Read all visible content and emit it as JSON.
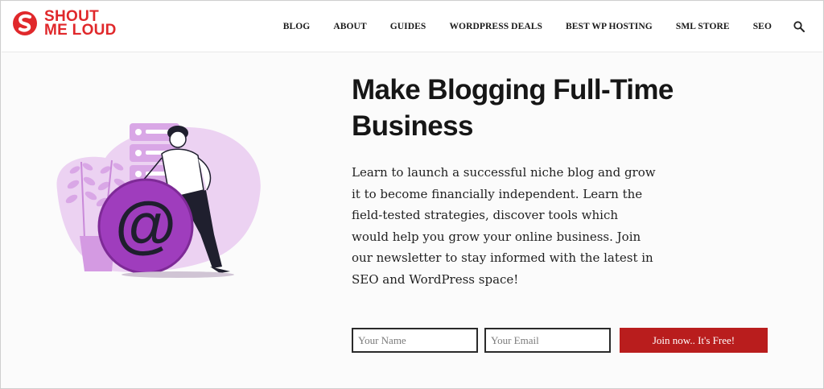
{
  "brand": {
    "line1": "SHOUT",
    "line2": "ME LOUD",
    "accent_color": "#e0282b"
  },
  "nav": {
    "items": [
      {
        "label": "BLOG"
      },
      {
        "label": "ABOUT"
      },
      {
        "label": "GUIDES"
      },
      {
        "label": "WORDPRESS DEALS"
      },
      {
        "label": "BEST WP HOSTING"
      },
      {
        "label": "SML STORE"
      },
      {
        "label": "SEO"
      }
    ],
    "search_icon": "search-icon"
  },
  "hero": {
    "headline": "Make Blogging Full-Time\nBusiness",
    "body": "Learn to launch a successful niche blog and grow it to become financially independent. Learn the field-tested strategies, discover tools which would help you grow your online business. Join our newsletter to stay informed with the latest in SEO and WordPress space!",
    "illustration": "man-leaning-on-at-sign-illustration",
    "illustration_colors": {
      "light_purple": "#e9c9ef",
      "mid_purple": "#d59ee3",
      "dark_purple": "#9f3dbd"
    }
  },
  "form": {
    "name_placeholder": "Your Name",
    "email_placeholder": "Your Email",
    "submit_label": "Join now.. It's Free!",
    "submit_color": "#b91d1d"
  }
}
